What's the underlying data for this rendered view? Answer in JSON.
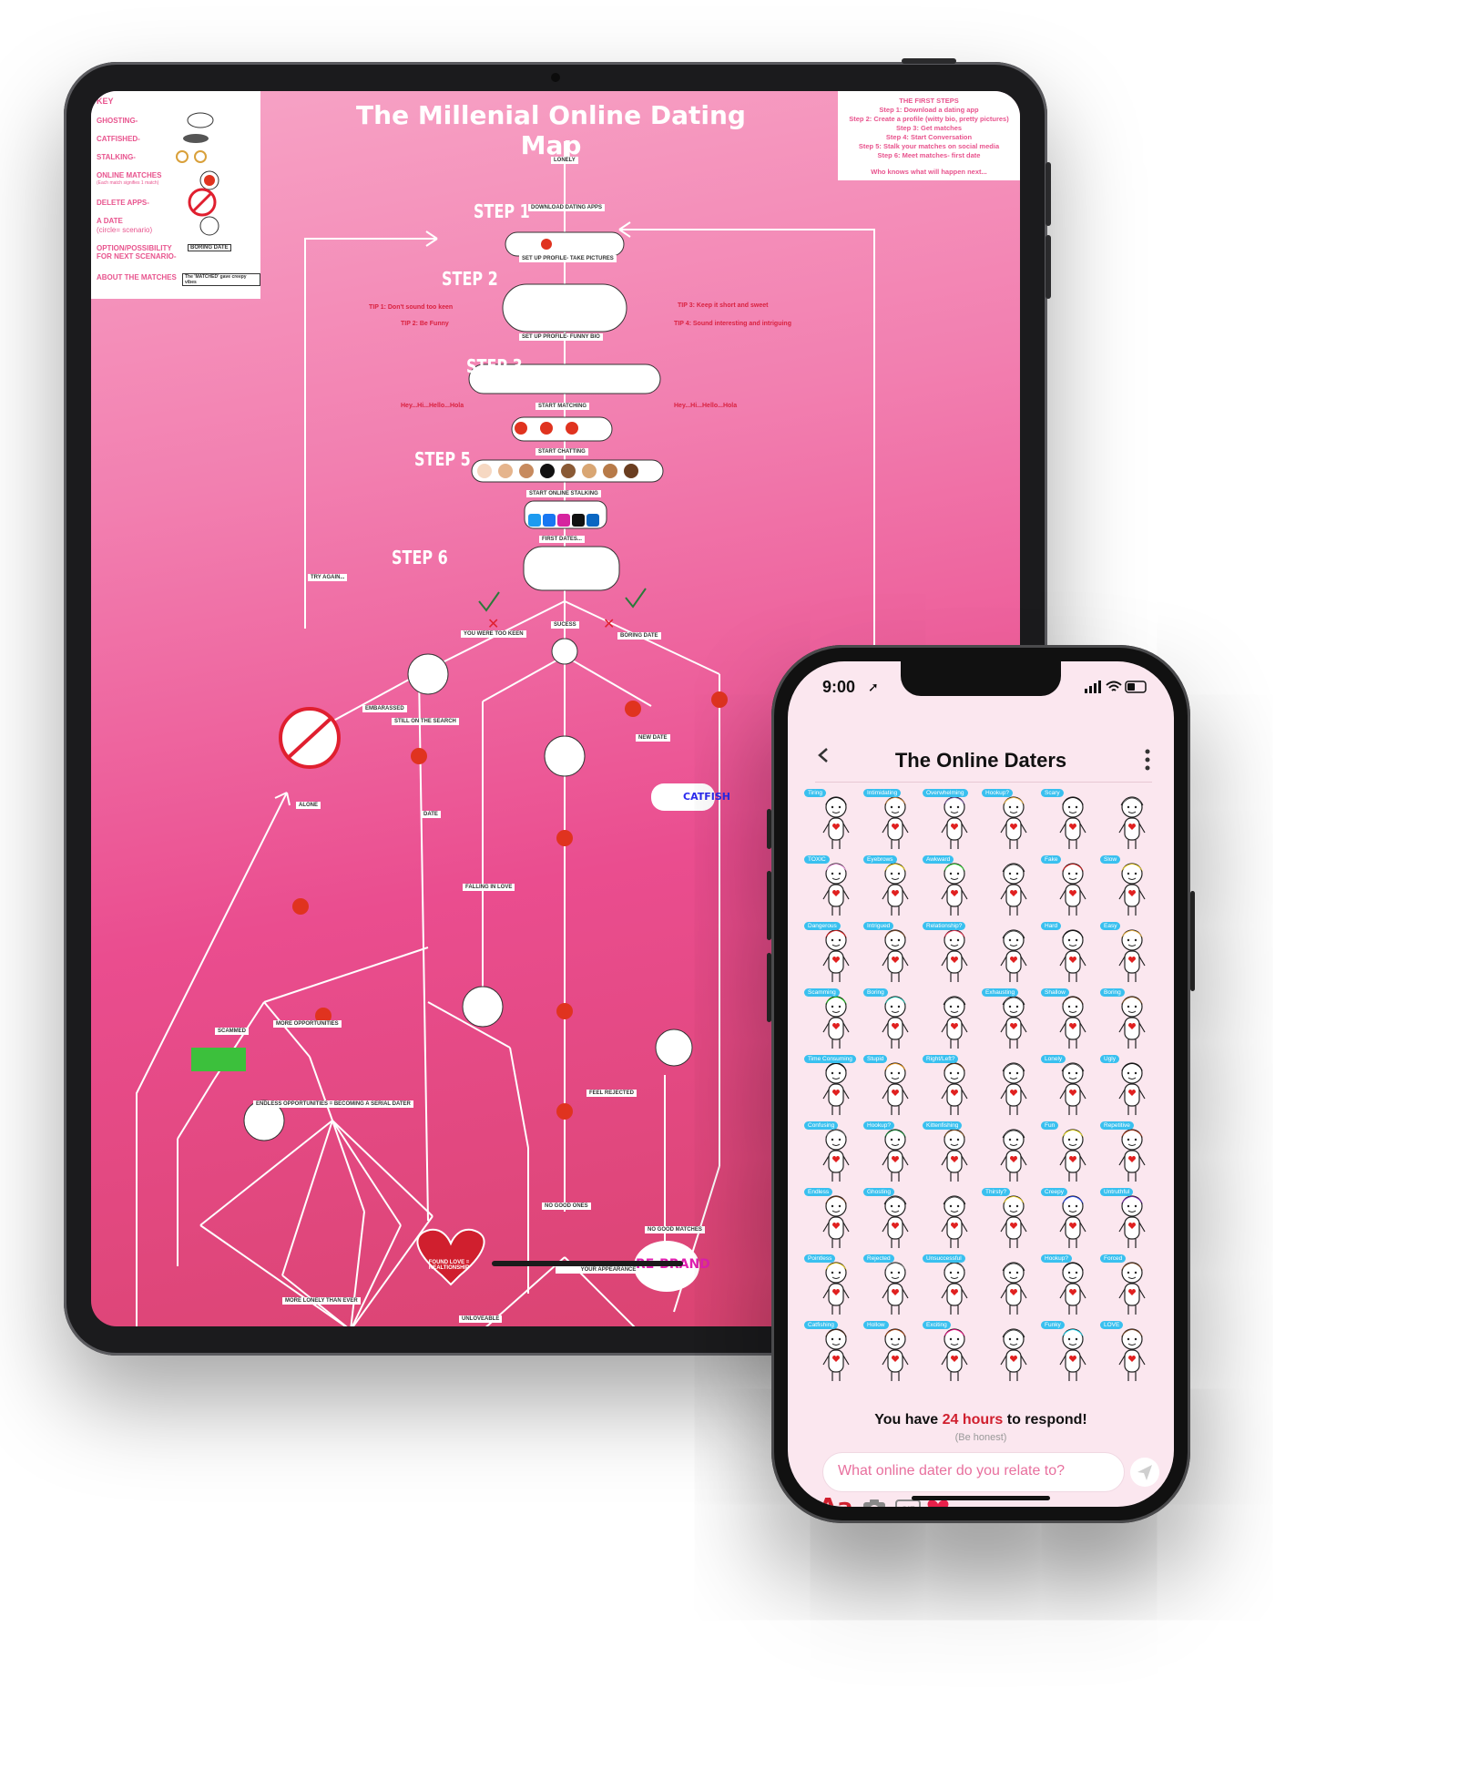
{
  "map": {
    "title": "The Millenial Online Dating Map",
    "key": {
      "title": "KEY",
      "items": [
        "GHOSTING-",
        "CATFISHED-",
        "STALKING-",
        "ONLINE MATCHES",
        "DELETE APPS-",
        "A DATE",
        "OPTION/POSSIBILITY FOR NEXT SCENARIO-",
        "ABOUT THE MATCHES"
      ],
      "date_sub": "(circle= scenario)",
      "matches_sub": "(Each match signifies 1 match)",
      "boring_date": "BORING DATE",
      "matched_note": "The 'MATCHED' gave creepy vibes"
    },
    "first_steps": {
      "title": "THE FIRST STEPS",
      "lines": [
        "Step 1: Download a dating app",
        "Step 2: Create a profile (witty bio, pretty pictures)",
        "Step 3: Get matches",
        "Step 4: Start Conversation",
        "Step 5: Stalk your matches on social media",
        "Step 6: Meet matches- first date"
      ],
      "footer": "Who knows what will happen next..."
    },
    "steps": [
      "STEP 1",
      "STEP 2",
      "STEP 3",
      "STEP 5",
      "STEP 6"
    ],
    "tips": [
      "TIP 1: Don't sound too keen",
      "TIP 2: Be Funny",
      "TIP 3: Keep it short and sweet",
      "TIP 4: Sound interesting and intriguing"
    ],
    "greeting": "Hey...Hi...Hello...Hola",
    "labels": {
      "lonely": "LONELY",
      "download": "DOWNLOAD DATING APPS",
      "setup": "SET UP PROFILE- TAKE PICTURES",
      "setup2": "SET UP PROFILE- FUNNY BIO",
      "matching": "START MATCHING",
      "chatting": "START CHATTING",
      "stalking": "START ONLINE STALKING",
      "first_dates": "FIRST DATES...",
      "try_again": "TRY AGAIN...",
      "too_keen": "YOU WERE TOO KEEN",
      "success": "SUCESS",
      "boring": "BORING DATE",
      "embarassed": "EMBARASSED",
      "still_search": "STILL ON THE SEARCH",
      "alone": "ALONE",
      "date": "DATE",
      "falling": "FALLING IN LOVE",
      "found_love": "FOUND LOVE = REALTIONSHIP",
      "rebrand": "RE-BRAND",
      "catfish": "CATFISH",
      "scammed": "SCAMMED",
      "endless": "ENDLESS OPPORTUNITIES = BECOMING A SERIAL DATER",
      "lonelier": "MORE LONELY THAN EVER",
      "unlovable": "UNLOVEABLE",
      "change": "YOU FEEL THE NEED TO CHANGE YOUR APPEARANCE",
      "no_good": "NO GOOD ONES",
      "no_good_matches": "NO GOOD MATCHES",
      "felt_rejected": "FEEL REJECTED",
      "new_date": "NEW DATE",
      "more_opps": "MORE OPPORTUNITIES"
    }
  },
  "phone": {
    "status": {
      "time": "9:00"
    },
    "title": "The Online Daters",
    "tags": [
      [
        "Tiring",
        "Intimidating",
        "Overwhelming",
        "Hookup?",
        "Scary",
        ""
      ],
      [
        "TOXIC",
        "Eyebrows",
        "Awkward",
        "",
        "Fake",
        "Slow"
      ],
      [
        "Dangerous",
        "Intrigued",
        "Relationship?",
        "",
        "Hard",
        "Easy"
      ],
      [
        "Scamming",
        "Boring",
        "",
        "Exhausting",
        "Shallow",
        "Boring"
      ],
      [
        "Time Consuming",
        "Stupid",
        "Right/Left?",
        "",
        "Lonely",
        "Ugly"
      ],
      [
        "Confusing",
        "Hookup?",
        "Kittenfishing",
        "",
        "Fun",
        "Repetitive"
      ],
      [
        "Endless",
        "Ghosting",
        "",
        "Thirsty?",
        "Creepy",
        "Untruthful"
      ],
      [
        "Pointless",
        "Rejected",
        "Unsuccessful",
        "",
        "Hookup?",
        "Forced"
      ],
      [
        "Catfishing",
        "Hollow",
        "Exciting",
        "",
        "Funky",
        "LOVE"
      ]
    ],
    "hair_colors": [
      [
        "#111111",
        "#d08a45",
        "#8a6ab0",
        "#f0b84a",
        "#111111",
        ""
      ],
      [
        "#f7a1e8",
        "#f7d82a",
        "#40e040",
        "",
        "#d81f1f",
        "#f2d22a"
      ],
      [
        "#e02020",
        "#7a4a2a",
        "#f03a5a",
        "",
        "#111111",
        "#f0b84a"
      ],
      [
        "#18c018",
        "#2ac6b8",
        "",
        "",
        "#4a2a1a",
        "#8a5a2a"
      ],
      [
        "#111111",
        "#f09a20",
        "#6a3a1a",
        "",
        "#ffffff",
        "#111111"
      ],
      [
        "#666666",
        "#1a8a3a",
        "#8a5a2a",
        "",
        "#f2e22a",
        "#a83a1a"
      ],
      [
        "#6a3a1a",
        "#ffffff",
        "",
        "#f2d22a",
        "#2a4af0",
        "#7a2ab0"
      ],
      [
        "#f2d22a",
        "#888888",
        "#555555",
        "",
        "#111111",
        "#7a4a2a"
      ],
      [
        "#4a2a1a",
        "#a84a1a",
        "#f01a8a",
        "",
        "#2ad6f0",
        "#7a4a2a"
      ]
    ],
    "prompt": {
      "before": "You have ",
      "highlight": "24 hours",
      "after": " to respond!",
      "sub": "(Be honest)"
    },
    "input_placeholder": "What online dater do you relate to?",
    "toolbar": {
      "aa": "Aa",
      "icons": [
        "camera-icon",
        "gif-icon",
        "heart-icon"
      ],
      "gif": "GIF"
    }
  },
  "colors": {
    "accent": "#e8548e",
    "red": "#d01f2e",
    "tag": "#39c0ef"
  }
}
